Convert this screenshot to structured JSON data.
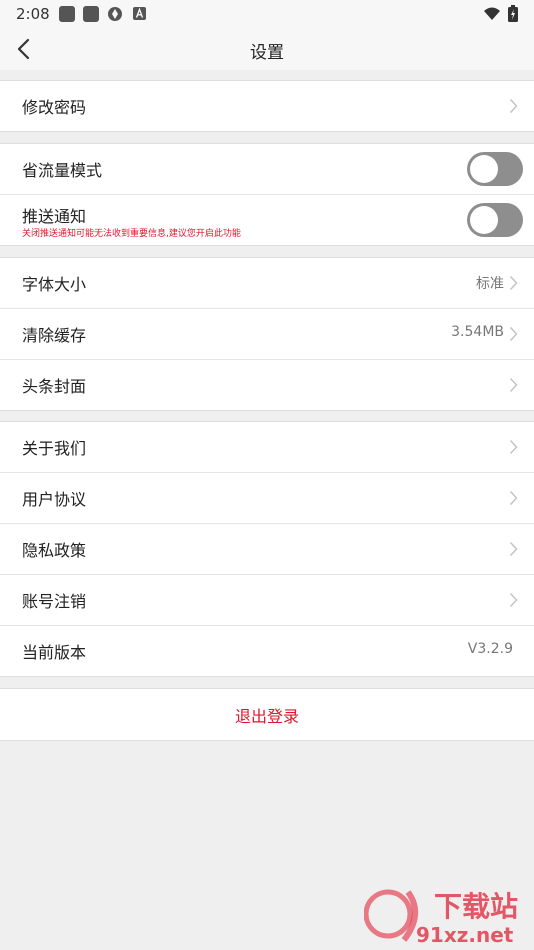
{
  "status_bar": {
    "time": "2:08"
  },
  "header": {
    "title": "设置"
  },
  "groups": [
    {
      "items": [
        {
          "label": "修改密码"
        }
      ]
    },
    {
      "items": [
        {
          "label": "省流量模式",
          "toggle": "off"
        },
        {
          "label": "推送通知",
          "sublabel": "关闭推送通知可能无法收到重要信息,建议您开启此功能",
          "toggle": "off"
        }
      ]
    },
    {
      "items": [
        {
          "label": "字体大小",
          "value": "标准"
        },
        {
          "label": "清除缓存",
          "value": "3.54MB"
        },
        {
          "label": "头条封面"
        }
      ]
    },
    {
      "items": [
        {
          "label": "关于我们"
        },
        {
          "label": "用户协议"
        },
        {
          "label": "隐私政策"
        },
        {
          "label": "账号注销"
        },
        {
          "label": "当前版本",
          "value": "V3.2.9"
        }
      ]
    }
  ],
  "logout": {
    "label": "退出登录"
  },
  "watermark": {
    "text": "下载站",
    "url_text": "91xz.net"
  },
  "colors": {
    "accent": "#e0162b",
    "background": "#efefef",
    "toggle_off": "#8e8e8e"
  }
}
